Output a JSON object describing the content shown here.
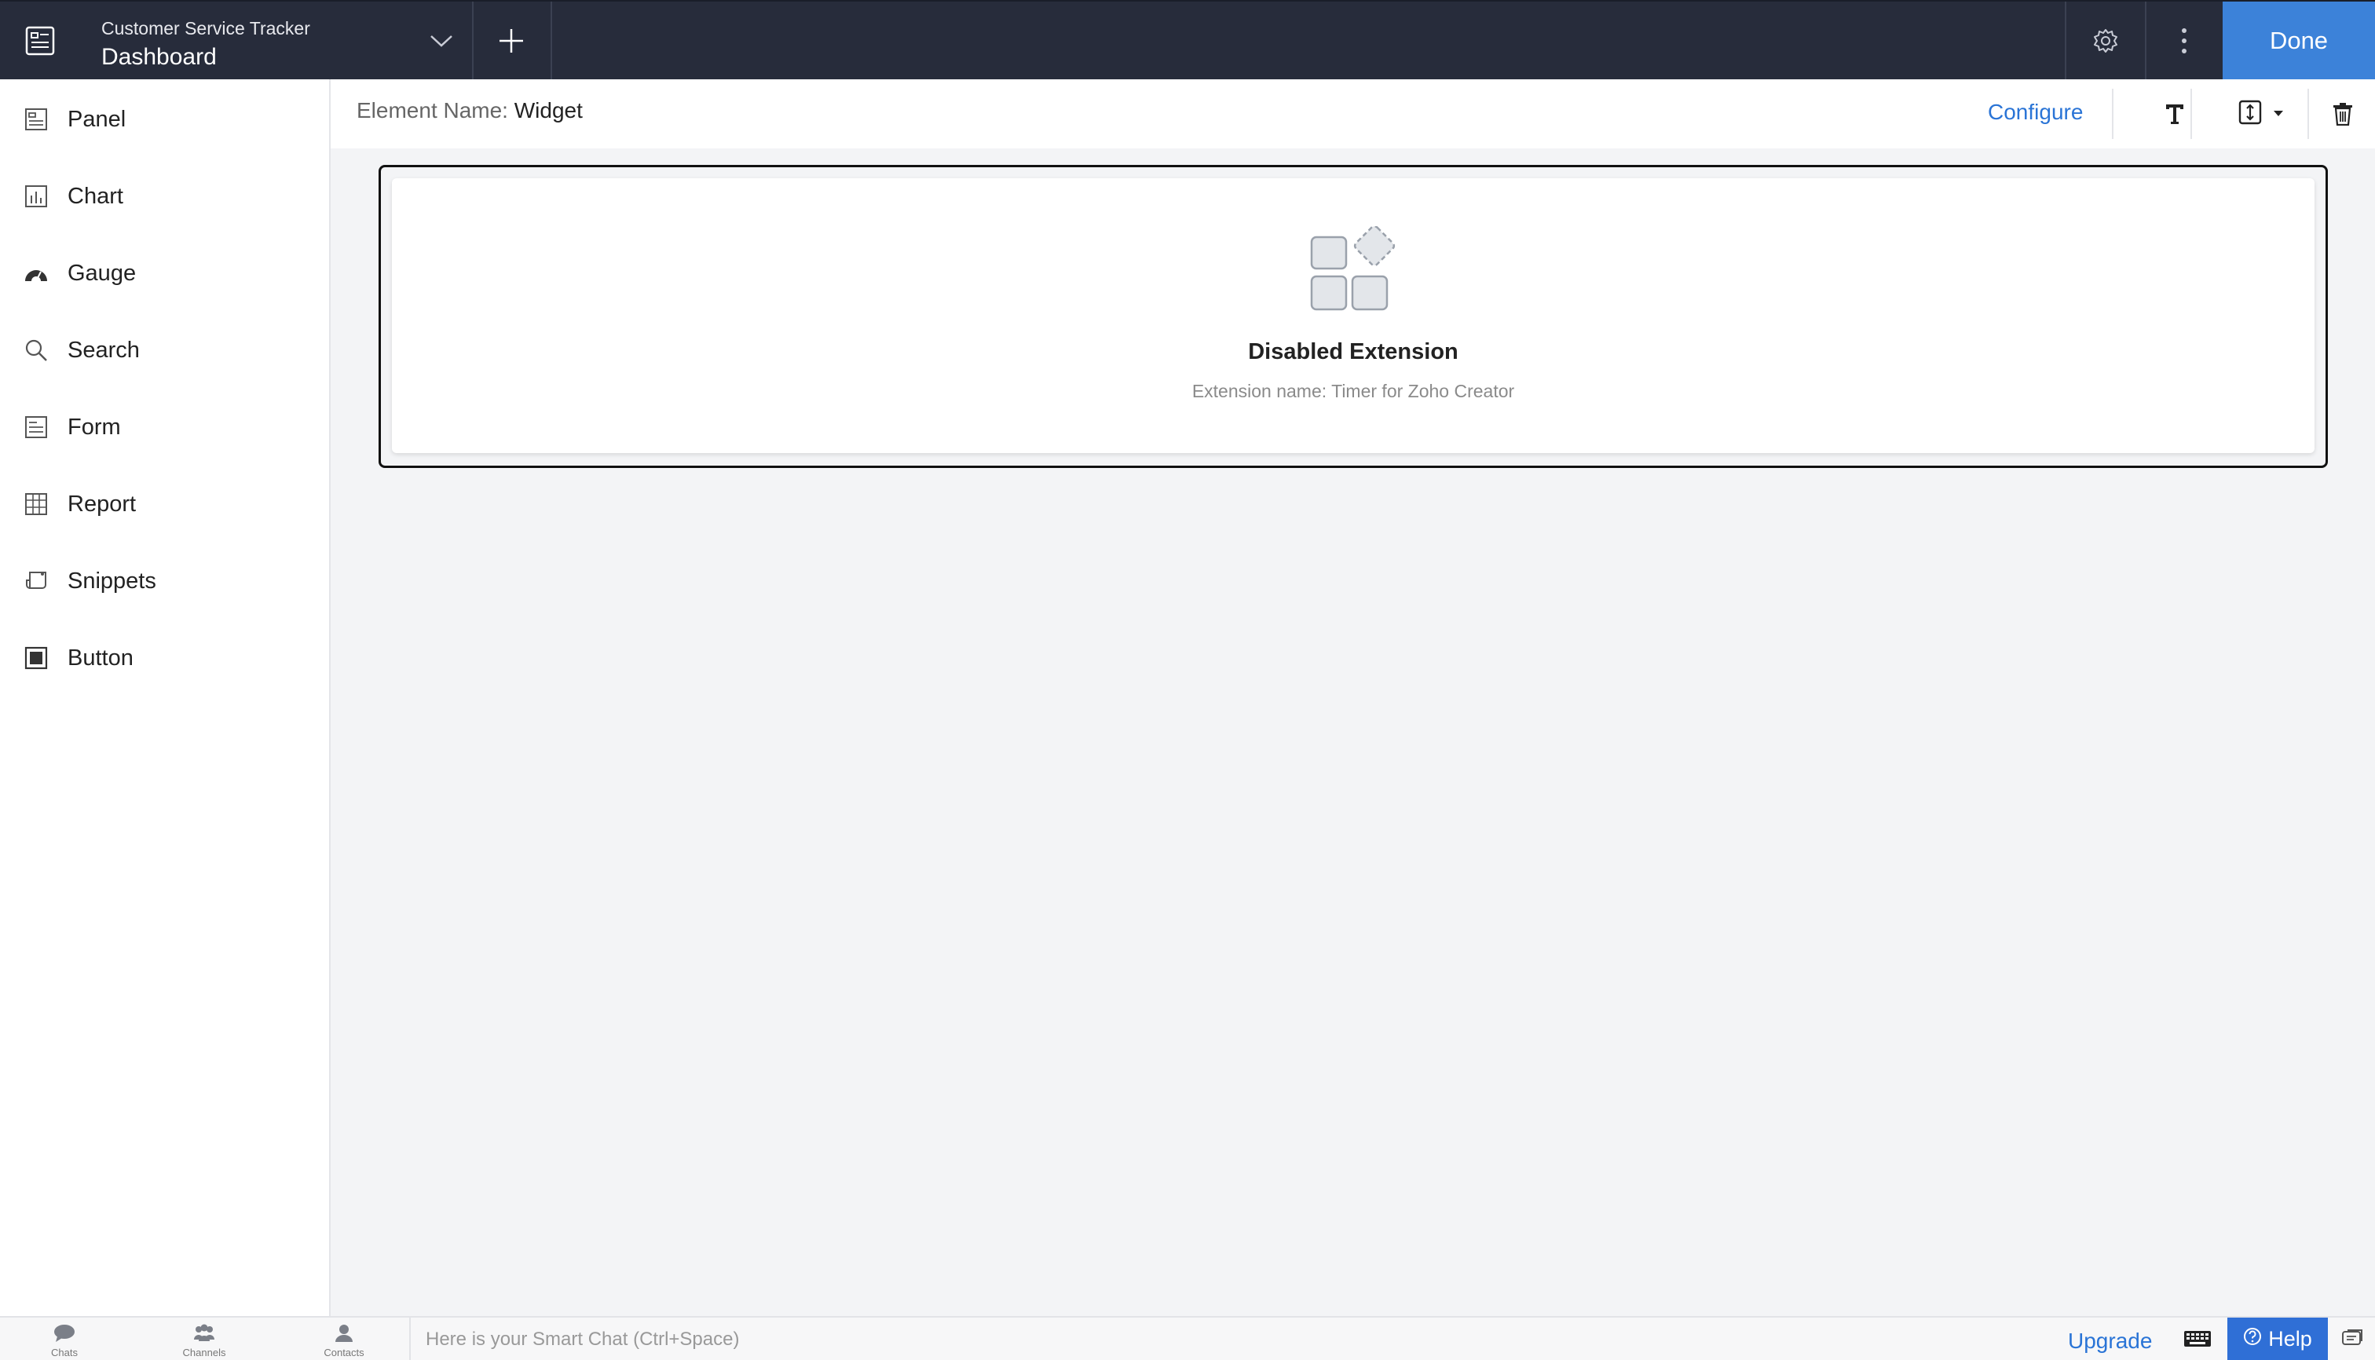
{
  "topbar": {
    "app_icon": "dashboard-app-icon",
    "app_name": "Customer Service Tracker",
    "page_name": "Dashboard",
    "chevron_icon": "chevron-down-icon",
    "add_icon": "plus-icon",
    "settings_icon": "gear-icon",
    "more_icon": "vertical-dots-icon",
    "done_label": "Done",
    "bg_color": "#272c3b",
    "done_color": "#3c82d9"
  },
  "sidebar": {
    "items": [
      {
        "label": "Panel",
        "icon": "panel-icon"
      },
      {
        "label": "Chart",
        "icon": "chart-icon"
      },
      {
        "label": "Gauge",
        "icon": "gauge-icon"
      },
      {
        "label": "Search",
        "icon": "search-icon"
      },
      {
        "label": "Form",
        "icon": "form-icon"
      },
      {
        "label": "Report",
        "icon": "grid-icon"
      },
      {
        "label": "Snippets",
        "icon": "snippet-icon"
      },
      {
        "label": "Button",
        "icon": "button-icon"
      }
    ]
  },
  "element_header": {
    "name_label": "Element Name:",
    "name_value": "Widget",
    "configure_label": "Configure",
    "text_icon": "text-format-icon",
    "resize_icon": "height-resize-icon",
    "dropdown_icon": "caret-down-icon",
    "delete_icon": "trash-icon",
    "accent_color": "#2a74d6"
  },
  "widget": {
    "icon": "extension-icon",
    "title": "Disabled Extension",
    "subtitle": "Extension name: Timer for Zoho Creator"
  },
  "bottombar": {
    "items": [
      {
        "label": "Chats",
        "icon": "chat-bubble-icon"
      },
      {
        "label": "Channels",
        "icon": "channels-icon"
      },
      {
        "label": "Contacts",
        "icon": "contact-icon"
      }
    ],
    "smart_chat_placeholder": "Here is your Smart Chat (Ctrl+Space)",
    "upgrade_label": "Upgrade",
    "keyboard_icon": "keyboard-icon",
    "help_label": "Help",
    "help_icon": "question-circle-icon",
    "last_icon": "chat-window-icon",
    "help_color": "#2f6fd6"
  }
}
